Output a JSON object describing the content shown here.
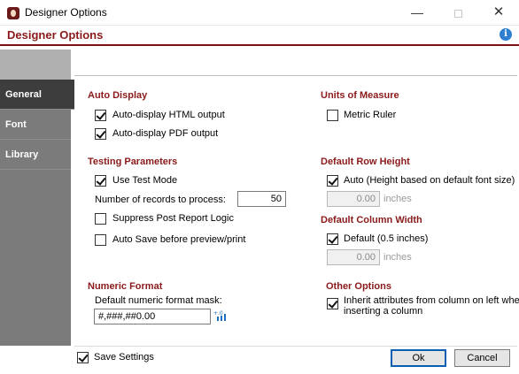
{
  "window": {
    "title": "Designer Options",
    "icon": "designer-app-icon"
  },
  "header": {
    "title": "Designer Options",
    "info_icon": "info-icon"
  },
  "sidebar": {
    "tabs": [
      {
        "label": "General"
      },
      {
        "label": "Font"
      },
      {
        "label": "Library"
      }
    ],
    "active": "General"
  },
  "auto_display": {
    "title": "Auto Display",
    "html_label": "Auto-display HTML output",
    "html_checked": true,
    "pdf_label": "Auto-display PDF output",
    "pdf_checked": true
  },
  "units": {
    "title": "Units of Measure",
    "metric_label": "Metric Ruler",
    "metric_checked": false
  },
  "testing": {
    "title": "Testing Parameters",
    "test_mode_label": "Use Test Mode",
    "test_mode_checked": true,
    "records_label": "Number of records to process:",
    "records_value": "50",
    "suppress_label": "Suppress Post Report Logic",
    "suppress_checked": false,
    "autosave_label": "Auto Save before preview/print",
    "autosave_checked": false
  },
  "row_height": {
    "title": "Default Row Height",
    "auto_label": "Auto  (Height based on default font size)",
    "auto_checked": true,
    "value": "0.00",
    "unit": "inches"
  },
  "column_width": {
    "title": "Default Column Width",
    "default_label": "Default  (0.5 inches)",
    "default_checked": true,
    "value": "0.00",
    "unit": "inches"
  },
  "numeric_format": {
    "title": "Numeric Format",
    "mask_label": "Default numeric format mask:",
    "mask_value": "#,###,##0.00"
  },
  "other_options": {
    "title": "Other Options",
    "inherit_label_line1": "Inherit attributes from column on left when",
    "inherit_label_line2": "inserting a column",
    "inherit_checked": true
  },
  "footer": {
    "save_label": "Save Settings",
    "save_checked": true,
    "ok_label": "Ok",
    "cancel_label": "Cancel"
  },
  "colors": {
    "accent": "#8b1a1a",
    "sidebar": "#7b7b7b",
    "sidebar_active": "#3d3d3d"
  }
}
